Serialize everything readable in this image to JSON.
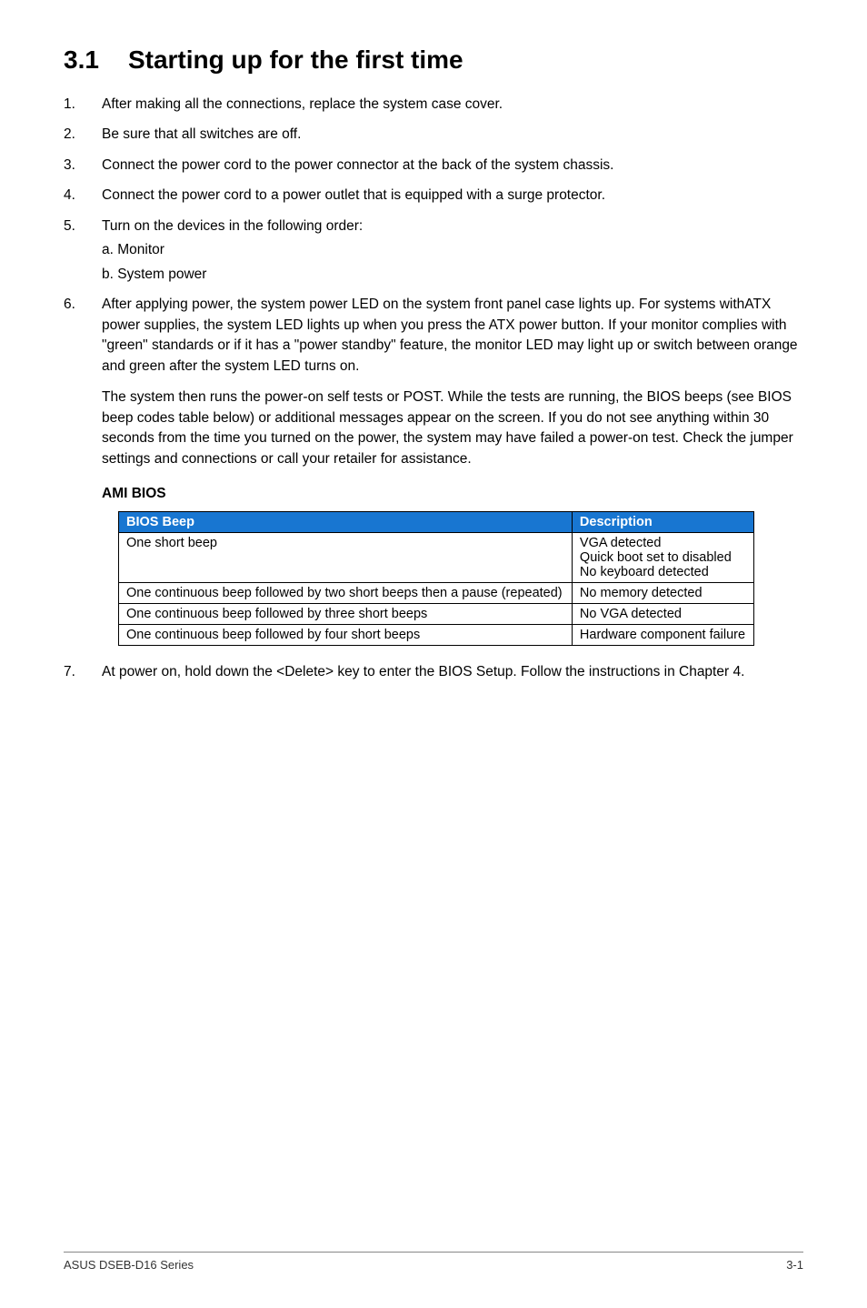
{
  "heading": {
    "number": "3.1",
    "title": "Starting up for the first time"
  },
  "steps": [
    {
      "text": "After making all the connections, replace the system case cover."
    },
    {
      "text": "Be sure that all switches are off."
    },
    {
      "text": "Connect the power cord to the power connector at the back of the system chassis."
    },
    {
      "text": "Connect the power cord to a power outlet that is equipped with a surge protector."
    },
    {
      "text": "Turn on the devices in the following order:",
      "subs": [
        "a. Monitor",
        "b. System power"
      ]
    },
    {
      "text": "After applying power, the system power LED on the system front panel case lights up. For systems withATX power supplies, the system LED lights up when you press the ATX power button. If your monitor complies with \"green\" standards or if it has a \"power standby\" feature, the monitor LED may light up or switch between orange and green after the system LED turns on.",
      "extra": "The system then runs the power-on self tests or POST. While the tests are running, the BIOS beeps (see BIOS beep codes table below) or additional messages appear on the screen. If you do not see anything within 30 seconds from the time you turned on the power, the system may have failed a power-on test. Check the jumper settings and connections or call your retailer for assistance."
    }
  ],
  "ami_title": "AMI BIOS",
  "table": {
    "headers": [
      "BIOS Beep",
      "Description"
    ],
    "rows": [
      {
        "beep": "One short beep",
        "desc": "VGA detected\nQuick boot set to disabled\nNo keyboard detected"
      },
      {
        "beep": "One continuous beep followed by two short beeps then a pause (repeated)",
        "desc": "No memory detected"
      },
      {
        "beep": "One continuous beep followed by three short beeps",
        "desc": "No VGA detected"
      },
      {
        "beep": "One continuous beep followed by four short beeps",
        "desc": "Hardware component failure"
      }
    ]
  },
  "step7": "At power on, hold down the <Delete> key to enter the BIOS Setup. Follow the instructions in Chapter 4.",
  "footer": {
    "left": "ASUS DSEB-D16 Series",
    "right": "3-1"
  }
}
